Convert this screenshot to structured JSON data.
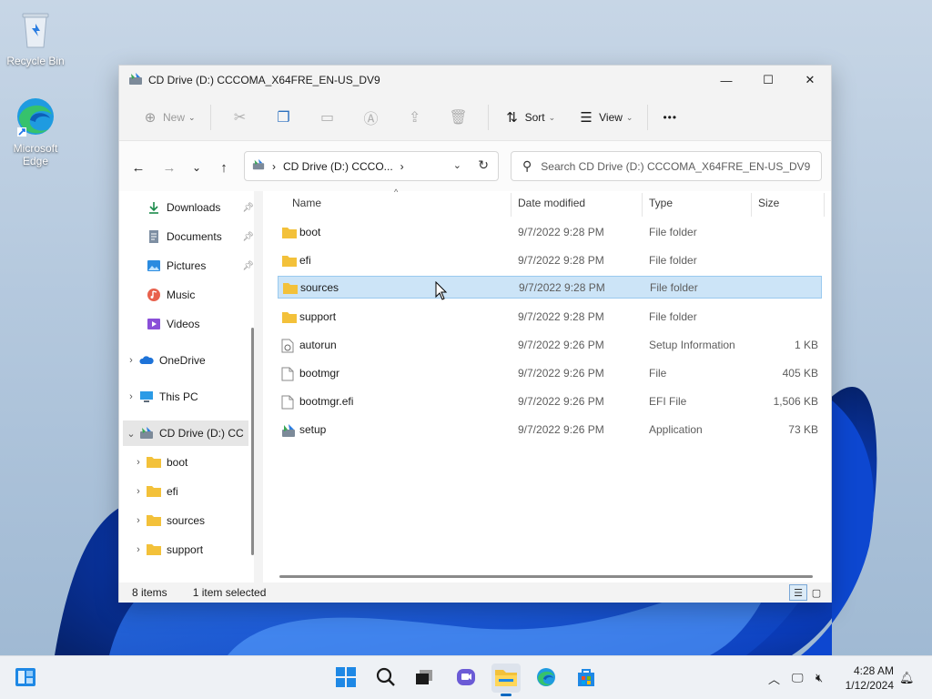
{
  "desktop": {
    "icons": [
      {
        "label": "Recycle Bin",
        "icon": "recycle-bin-icon"
      },
      {
        "label": "Microsoft Edge",
        "icon": "edge-icon"
      }
    ]
  },
  "window": {
    "title": "CD Drive (D:) CCCOMA_X64FRE_EN-US_DV9",
    "controls": {
      "minimize": "—",
      "maximize": "☐",
      "close": "✕"
    }
  },
  "commandbar": {
    "new_label": "New",
    "sort_label": "Sort",
    "view_label": "View",
    "more_label": "•••"
  },
  "navigation": {
    "back": "←",
    "forward": "→",
    "recent": "⌄",
    "up": "↑",
    "address_crumb": "CD Drive (D:) CCCO...",
    "search_placeholder": "Search CD Drive (D:) CCCOMA_X64FRE_EN-US_DV9"
  },
  "sidebar": {
    "items": [
      {
        "label": "Downloads",
        "pinned": true
      },
      {
        "label": "Documents",
        "pinned": true
      },
      {
        "label": "Pictures",
        "pinned": true
      },
      {
        "label": "Music",
        "pinned": false
      },
      {
        "label": "Videos",
        "pinned": false
      },
      {
        "label": "OneDrive"
      },
      {
        "label": "This PC"
      },
      {
        "label": "CD Drive (D:) CC"
      },
      {
        "label": "boot"
      },
      {
        "label": "efi"
      },
      {
        "label": "sources"
      },
      {
        "label": "support"
      }
    ]
  },
  "files": {
    "columns": {
      "name": "Name",
      "date": "Date modified",
      "type": "Type",
      "size": "Size"
    },
    "rows": [
      {
        "name": "boot",
        "date": "9/7/2022 9:28 PM",
        "type": "File folder",
        "size": "",
        "kind": "folder"
      },
      {
        "name": "efi",
        "date": "9/7/2022 9:28 PM",
        "type": "File folder",
        "size": "",
        "kind": "folder"
      },
      {
        "name": "sources",
        "date": "9/7/2022 9:28 PM",
        "type": "File folder",
        "size": "",
        "kind": "folder",
        "selected": true
      },
      {
        "name": "support",
        "date": "9/7/2022 9:28 PM",
        "type": "File folder",
        "size": "",
        "kind": "folder"
      },
      {
        "name": "autorun",
        "date": "9/7/2022 9:26 PM",
        "type": "Setup Information",
        "size": "1 KB",
        "kind": "setupinfo"
      },
      {
        "name": "bootmgr",
        "date": "9/7/2022 9:26 PM",
        "type": "File",
        "size": "405 KB",
        "kind": "file"
      },
      {
        "name": "bootmgr.efi",
        "date": "9/7/2022 9:26 PM",
        "type": "EFI File",
        "size": "1,506 KB",
        "kind": "file"
      },
      {
        "name": "setup",
        "date": "9/7/2022 9:26 PM",
        "type": "Application",
        "size": "73 KB",
        "kind": "app"
      }
    ]
  },
  "status": {
    "count": "8 items",
    "selection": "1 item selected"
  },
  "taskbar": {
    "time": "4:28 AM",
    "date": "1/12/2024"
  },
  "colors": {
    "accent": "#0067c0",
    "folder": "#f3c13a",
    "selection": "#cce4f7"
  }
}
